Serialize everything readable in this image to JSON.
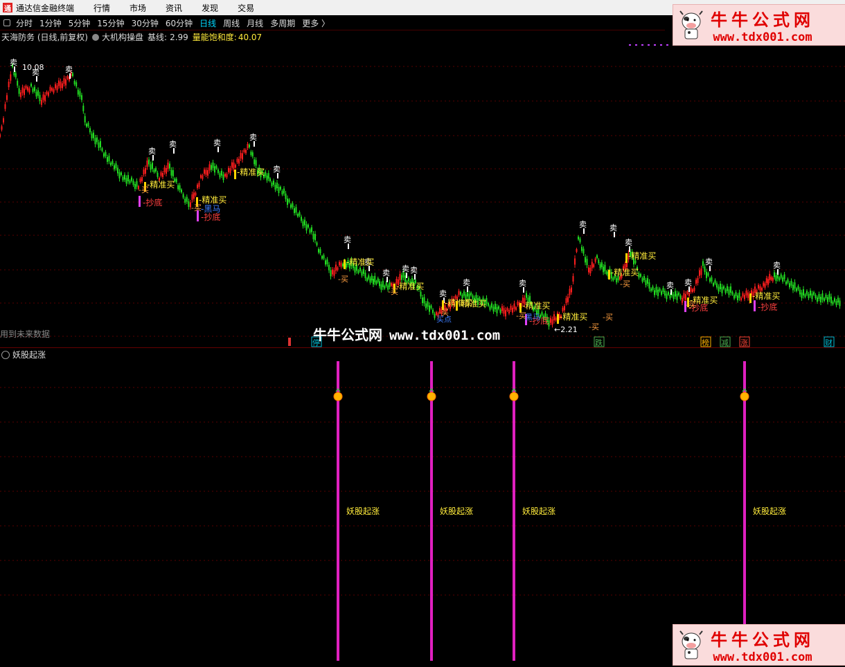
{
  "app": {
    "title": "通达信金融终端",
    "logo_char": "通"
  },
  "menu": [
    "行情",
    "市场",
    "资讯",
    "发现",
    "交易"
  ],
  "periods": [
    {
      "label": "分时",
      "active": false
    },
    {
      "label": "1分钟",
      "active": false
    },
    {
      "label": "5分钟",
      "active": false
    },
    {
      "label": "15分钟",
      "active": false
    },
    {
      "label": "30分钟",
      "active": false
    },
    {
      "label": "60分钟",
      "active": false
    },
    {
      "label": "日线",
      "active": true
    },
    {
      "label": "周线",
      "active": false
    },
    {
      "label": "月线",
      "active": false
    },
    {
      "label": "多周期",
      "active": false
    },
    {
      "label": "更多 〉",
      "active": false
    }
  ],
  "info": {
    "stock": "天海防务 (日线,前复权)",
    "indicator": "大机构操盘",
    "base_label": "基线:",
    "base_value": "2.99",
    "sat_label": "量能饱和度:",
    "sat_value": "40.07"
  },
  "brand": {
    "cn": "牛牛公式网",
    "url": "www.tdx001.com"
  },
  "watermark": {
    "cn": "牛牛公式网",
    "url": "www.tdx001.com"
  },
  "future_note": "用到未来数据",
  "sub_panel": {
    "title": "妖股起涨",
    "signal_label": "妖股起涨"
  },
  "chart_data": {
    "type": "candlestick",
    "price_max_label": "10.08",
    "price_min_label": "2.21",
    "sell_label": "卖",
    "buy_label": "买",
    "labels": [
      "精准买",
      "抄底",
      "黑马",
      "买点",
      "买"
    ],
    "event_tags": [
      {
        "text": "停",
        "color": "#00bcd4"
      },
      {
        "text": "跌",
        "color": "#4caf50"
      },
      {
        "text": "榜",
        "color": "#ffb300"
      },
      {
        "text": "减",
        "color": "#4caf50"
      },
      {
        "text": "涨",
        "color": "#f44336"
      },
      {
        "text": "财",
        "color": "#00bcd4"
      }
    ],
    "signal_count": 4
  }
}
